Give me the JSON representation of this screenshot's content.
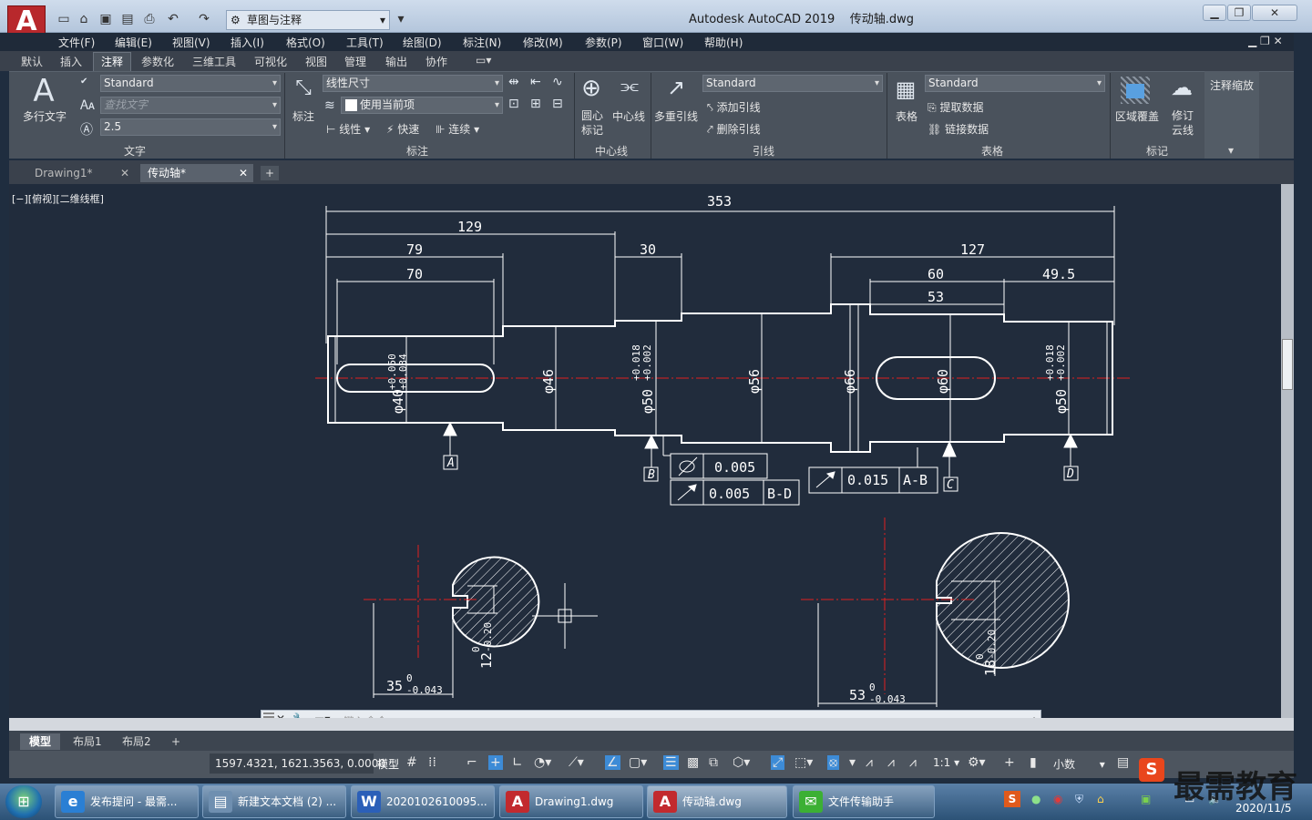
{
  "title": {
    "app": "Autodesk AutoCAD 2019",
    "file": "传动轴.dwg",
    "workspace": "草图与注释"
  },
  "menu": [
    "文件(F)",
    "编辑(E)",
    "视图(V)",
    "插入(I)",
    "格式(O)",
    "工具(T)",
    "绘图(D)",
    "标注(N)",
    "修改(M)",
    "参数(P)",
    "窗口(W)",
    "帮助(H)"
  ],
  "ribbon_tabs": [
    "默认",
    "插入",
    "注释",
    "参数化",
    "三维工具",
    "可视化",
    "视图",
    "管理",
    "输出",
    "协作"
  ],
  "ribbon_active_tab": "注释",
  "ribbon": {
    "text": {
      "big_label": "多行文字",
      "style": "Standard",
      "find_placeholder": "查找文字",
      "height": "2.5",
      "title": "文字"
    },
    "dim": {
      "big_label": "标注",
      "style": "线性尺寸",
      "layer": "使用当前项",
      "linear": "线性",
      "quick": "快速",
      "continue": "连续",
      "title": "标注"
    },
    "centerline": {
      "center_mark": "圆心\n标记",
      "centerline": "中心线",
      "title": "中心线"
    },
    "leader": {
      "big_label": "多重引线",
      "style": "Standard",
      "add": "添加引线",
      "remove": "删除引线",
      "title": "引线"
    },
    "table": {
      "big_label": "表格",
      "style": "Standard",
      "extract": "提取数据",
      "link": "链接数据",
      "title": "表格"
    },
    "markup": {
      "wipeout": "区域覆盖",
      "revcloud": "修订\n云线",
      "title": "标记"
    },
    "scale": {
      "label": "注释缩放"
    }
  },
  "doc_tabs": [
    {
      "label": "Drawing1*",
      "active": false
    },
    {
      "label": "传动轴*",
      "active": true
    }
  ],
  "viewport_label": "[−][俯视][二维线框]",
  "command_placeholder": "键入命令",
  "layout_tabs": [
    "模型",
    "布局1",
    "布局2"
  ],
  "status": {
    "coords": "1597.4321, 1621.3563, 0.0000",
    "model": "模型",
    "scale": "1:1",
    "units": "小数"
  },
  "drawing": {
    "overall": [
      "353",
      "129",
      "79",
      "70",
      "30",
      "127",
      "60",
      "49.5",
      "53"
    ],
    "diameters": [
      "φ40",
      "φ46",
      "φ50",
      "φ56",
      "φ66",
      "φ60",
      "φ50"
    ],
    "tol_40": [
      "+0.050",
      "+0.034"
    ],
    "tol_50": [
      "+0.018",
      "+0.002"
    ],
    "datums": [
      "A",
      "B",
      "C",
      "D"
    ],
    "gdt": [
      {
        "value": "0.005",
        "datum": ""
      },
      {
        "value": "0.005",
        "datum": "B-D"
      },
      {
        "value": "0.015",
        "datum": "A-B"
      }
    ],
    "section1": {
      "width": "35",
      "width_tol": "-0.043",
      "depth": "12",
      "depth_tol": "-0.20"
    },
    "section2": {
      "width": "53",
      "width_tol": "-0.043",
      "depth": "18",
      "depth_tol": "-0.20"
    }
  },
  "taskbar": [
    {
      "label": "发布提问 - 最需...",
      "icon": "ie-icon",
      "color": "#2a7fd4"
    },
    {
      "label": "新建文本文档 (2) ...",
      "icon": "notepad-icon",
      "color": "#6f8fb0"
    },
    {
      "label": "2020102610095...",
      "icon": "word-icon",
      "color": "#2b5fb8"
    },
    {
      "label": "Drawing1.dwg",
      "icon": "autocad-icon",
      "color": "#c22a2e"
    },
    {
      "label": "传动轴.dwg",
      "icon": "autocad-icon",
      "color": "#c22a2e"
    },
    {
      "label": "文件传输助手",
      "icon": "wechat-icon",
      "color": "#3cb034"
    }
  ],
  "clock": {
    "date": "2020/11/5"
  },
  "watermark": "最需教育"
}
